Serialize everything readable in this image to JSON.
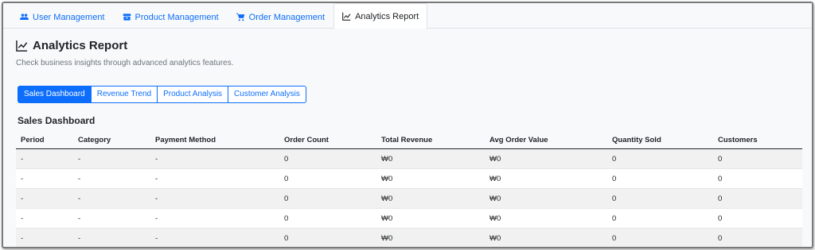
{
  "nav": {
    "tabs": [
      {
        "label": "User Management",
        "icon": "users-icon"
      },
      {
        "label": "Product Management",
        "icon": "box-icon"
      },
      {
        "label": "Order Management",
        "icon": "cart-icon"
      },
      {
        "label": "Analytics Report",
        "icon": "chart-line-icon",
        "active": true
      }
    ]
  },
  "page": {
    "title": "Analytics Report",
    "subtitle": "Check business insights through advanced analytics features."
  },
  "subtabs": [
    {
      "label": "Sales Dashboard",
      "active": true
    },
    {
      "label": "Revenue Trend"
    },
    {
      "label": "Product Analysis"
    },
    {
      "label": "Customer Analysis"
    }
  ],
  "section": {
    "title": "Sales Dashboard"
  },
  "table": {
    "headers": [
      "Period",
      "Category",
      "Payment Method",
      "Order Count",
      "Total Revenue",
      "Avg Order Value",
      "Quantity Sold",
      "Customers"
    ],
    "rows": [
      [
        "-",
        "-",
        "-",
        "0",
        "₩0",
        "₩0",
        "0",
        "0"
      ],
      [
        "-",
        "-",
        "-",
        "0",
        "₩0",
        "₩0",
        "0",
        "0"
      ],
      [
        "-",
        "-",
        "-",
        "0",
        "₩0",
        "₩0",
        "0",
        "0"
      ],
      [
        "-",
        "-",
        "-",
        "0",
        "₩0",
        "₩0",
        "0",
        "0"
      ],
      [
        "-",
        "-",
        "-",
        "0",
        "₩0",
        "₩0",
        "0",
        "0"
      ]
    ]
  },
  "colors": {
    "primary": "#0d6efd",
    "text": "#212529",
    "muted": "#6c757d",
    "background": "#f8f9fa"
  }
}
